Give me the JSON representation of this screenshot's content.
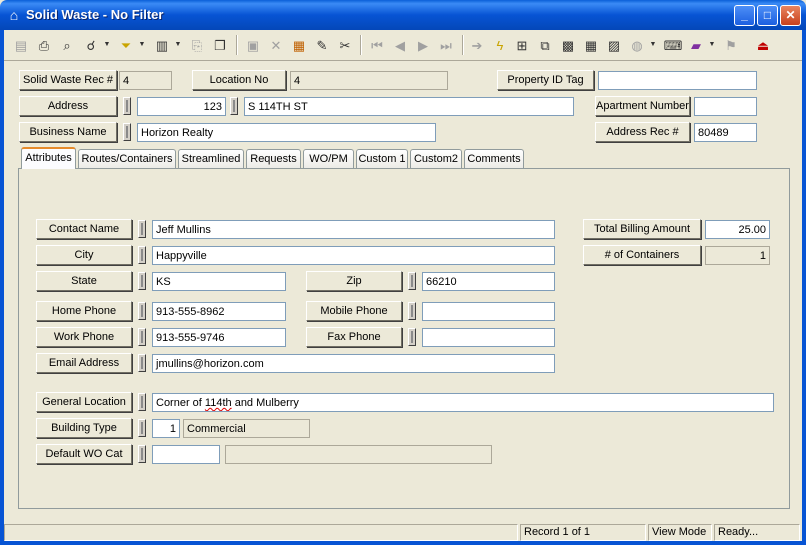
{
  "window": {
    "title": "Solid Waste - No Filter",
    "minimize": "_",
    "maximize": "□",
    "close": "✕",
    "app_icon": "house-icon"
  },
  "header": {
    "rec_label": "Solid Waste Rec #",
    "rec_value": "4",
    "location_label": "Location No",
    "location_value": "4",
    "property_label": "Property ID Tag",
    "property_value": "",
    "address_label": "Address",
    "address_number": "123",
    "address_street": "S 114TH ST",
    "apartment_label": "Apartment Number",
    "apartment_value": "",
    "business_label": "Business Name",
    "business_value": "Horizon Realty",
    "address_rec_label": "Address Rec #",
    "address_rec_value": "80489"
  },
  "tabs": [
    "Attributes",
    "Routes/Containers",
    "Streamlined",
    "Requests",
    "WO/PM",
    "Custom 1",
    "Custom2",
    "Comments"
  ],
  "attributes": {
    "contact_label": "Contact Name",
    "contact_value": "Jeff Mullins",
    "city_label": "City",
    "city_value": "Happyville",
    "state_label": "State",
    "state_value": "KS",
    "zip_label": "Zip",
    "zip_value": "66210",
    "home_phone_label": "Home Phone",
    "home_phone_value": "913-555-8962",
    "mobile_phone_label": "Mobile Phone",
    "mobile_phone_value": "",
    "work_phone_label": "Work Phone",
    "work_phone_value": "913-555-9746",
    "fax_phone_label": "Fax Phone",
    "fax_phone_value": "",
    "email_label": "Email Address",
    "email_value": "jmullins@horizon.com",
    "general_location_label": "General Location",
    "general_location_pre": "Corner of ",
    "general_location_mid": "114th",
    "general_location_post": " and Mulberry",
    "building_type_label": "Building Type",
    "building_type_code": "1",
    "building_type_value": "Commercial",
    "default_wo_label": "Default WO Cat",
    "default_wo_code": "",
    "default_wo_value": "",
    "total_billing_label": "Total Billing Amount",
    "total_billing_value": "25.00",
    "containers_label": "# of Containers",
    "containers_value": "1"
  },
  "status": {
    "blank": "",
    "record": "Record 1 of 1",
    "mode": "View Mode",
    "state": "Ready..."
  }
}
